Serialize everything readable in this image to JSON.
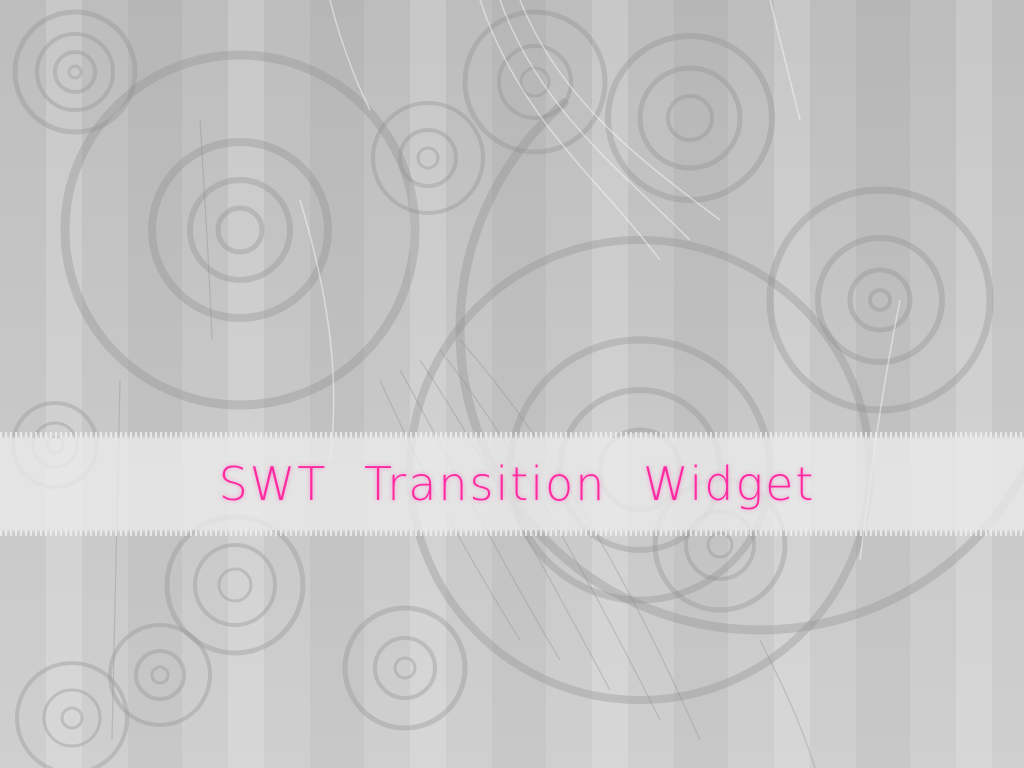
{
  "splash": {
    "title": "SWT Transition Widget"
  },
  "theme": {
    "background": "#c4c4c4",
    "banner": "#ececec",
    "title_color": "#ff2aa0",
    "ornament_color": "#9a9a9a"
  },
  "decorations": {
    "ornament": "spiral-swirl-pattern",
    "background": "vertical-stripes"
  }
}
